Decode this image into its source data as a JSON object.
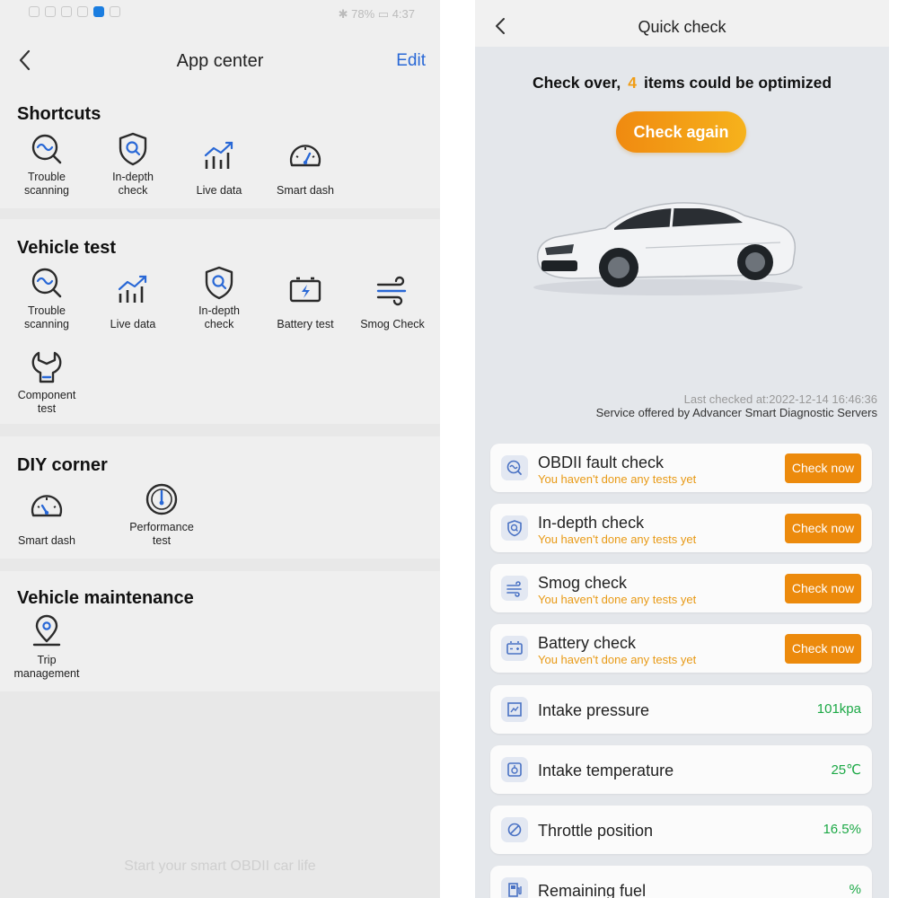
{
  "left": {
    "status": {
      "battery": "78%",
      "time": "4:37"
    },
    "header": {
      "title": "App center",
      "edit": "Edit"
    },
    "shortcuts": {
      "title": "Shortcuts",
      "items": [
        {
          "l1": "Trouble",
          "l2": "scanning",
          "icon": "trouble-scan-icon"
        },
        {
          "l1": "In-depth",
          "l2": "check",
          "icon": "shield-search-icon"
        },
        {
          "l1": "Live data",
          "l2": "",
          "icon": "chart-icon"
        },
        {
          "l1": "Smart dash",
          "l2": "",
          "icon": "gauge-icon"
        }
      ]
    },
    "vehicle_test": {
      "title": "Vehicle test",
      "items": [
        {
          "l1": "Trouble",
          "l2": "scanning",
          "icon": "trouble-scan-icon"
        },
        {
          "l1": "Live data",
          "l2": "",
          "icon": "chart-icon"
        },
        {
          "l1": "In-depth",
          "l2": "check",
          "icon": "shield-search-icon"
        },
        {
          "l1": "Battery test",
          "l2": "",
          "icon": "battery-icon"
        },
        {
          "l1": "Smog Check",
          "l2": "",
          "icon": "wind-icon"
        },
        {
          "l1": "Component",
          "l2": "test",
          "icon": "wrench-icon"
        }
      ]
    },
    "diy_corner": {
      "title": "DIY corner",
      "items": [
        {
          "l1": "Smart dash",
          "l2": "",
          "icon": "gauge-icon"
        },
        {
          "l1": "Performance",
          "l2": "test",
          "icon": "speedometer-icon"
        }
      ]
    },
    "maintenance": {
      "title": "Vehicle maintenance",
      "items": [
        {
          "l1": "Trip",
          "l2": "management",
          "icon": "location-pin-icon"
        }
      ]
    },
    "footer": "Start your smart OBDII car life"
  },
  "right": {
    "header": {
      "title": "Quick check"
    },
    "summary": {
      "prefix": "Check over,",
      "count": "4",
      "suffix": "items could be optimized"
    },
    "again_button": "Check again",
    "last_checked": "Last checked at:2022-12-14 16:46:36",
    "service": "Service offered by Advancer Smart Diagnostic Servers",
    "checks": [
      {
        "name": "OBDII fault check",
        "status": "You haven't done any tests yet",
        "button": "Check now"
      },
      {
        "name": "In-depth check",
        "status": "You haven't done any tests yet",
        "button": "Check now"
      },
      {
        "name": "Smog check",
        "status": "You haven't done any tests yet",
        "button": "Check now"
      },
      {
        "name": "Battery check",
        "status": "You haven't done any tests yet",
        "button": "Check now"
      }
    ],
    "readings": [
      {
        "name": "Intake pressure",
        "value": "101kpa"
      },
      {
        "name": "Intake temperature",
        "value": "25℃"
      },
      {
        "name": "Throttle position",
        "value": "16.5%"
      },
      {
        "name": "Remaining fuel",
        "value": "%"
      }
    ],
    "colors": {
      "accent_orange": "#ec8a0c",
      "value_green": "#1ba845",
      "link_blue": "#2968d6"
    }
  }
}
